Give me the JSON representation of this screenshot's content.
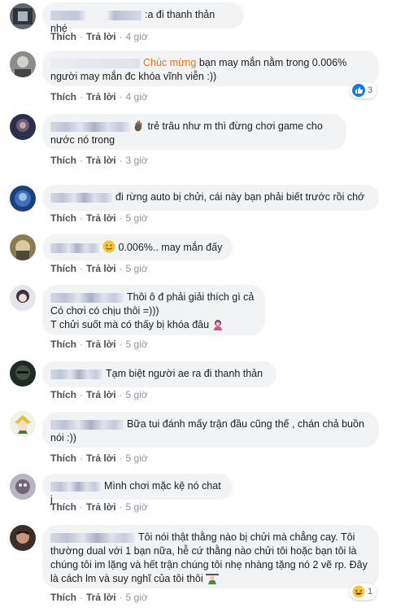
{
  "actions": {
    "like": "Thích",
    "reply": "Trả lời",
    "separator": "·"
  },
  "colors": {
    "bubble": "#f2f3f5",
    "highlight": "#e9711c",
    "like_blue": "#1877f2"
  },
  "comments": [
    {
      "text": ":a đi thanh thản nhé",
      "time": "4 giờ"
    },
    {
      "highlight": "Chúc mừng",
      "text": "bạn may mắn nằm trong 0.006% người may mắn đc khóa vĩnh viễn :))",
      "time": "4 giờ",
      "reaction": {
        "icon": "like-icon",
        "count": "3"
      }
    },
    {
      "text": "trẻ trâu như m thì đừng chơi game cho nước nó trong",
      "time": "3 giờ",
      "emoji": "waving-hand-icon"
    },
    {
      "text": "đi rừng auto bị chửi, cái này bạn phải biết trước rồi chớ",
      "time": "5 giờ"
    },
    {
      "text": "0.006%.. may mắn đấy",
      "time": "5 giờ",
      "emoji": "smiling-face-icon"
    },
    {
      "lines": [
        "Thôi ô đ phải giải thích gì cả",
        "Có chơi có chịu thôi =)))",
        "T chửi suốt mà có thấy bị khóa đâu"
      ],
      "time": "5 giờ",
      "emoji": "person-tipping-hand-icon"
    },
    {
      "text": "Tạm biệt người ae ra đi thanh thản",
      "time": "5 giờ"
    },
    {
      "text": "Bữa tui đánh mấy trận đầu cũng thế , chán chả buồn nói :))",
      "time": "5 giờ"
    },
    {
      "text": "Mình chơi mặc kệ nó chat j",
      "time": "5 giờ"
    },
    {
      "text": "Tôi nói thật thằng nào bị chửi mà chẳng cay. Tôi thường dual với 1 bạn nữa, hễ cứ thằng nào chửi tôi hoặc bạn tôi là chúng tôi im lặng và hết trận chúng tôi nhẹ nhàng tặng nó 2 vẽ rp. Đây là cách lm và suy nghĩ của tôi thôi",
      "time": "5 giờ",
      "emoji": "person-lifting-weights-icon",
      "reaction": {
        "icon": "laughing-face-icon",
        "count": "1"
      }
    }
  ]
}
